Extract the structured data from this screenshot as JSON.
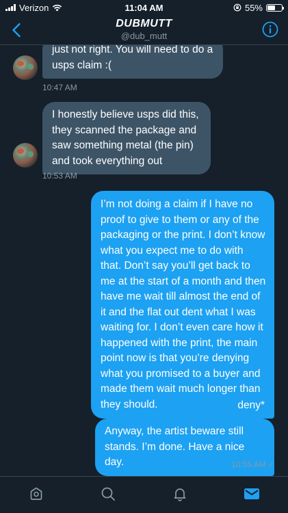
{
  "status_bar": {
    "carrier": "Verizon",
    "time": "11:04 AM",
    "battery": "55%",
    "battery_level": 0.55
  },
  "header": {
    "title": "DUBMUTT",
    "handle": "@dub_mutt"
  },
  "messages": [
    {
      "direction": "received",
      "text": "just not right. You will need to do a usps claim :(",
      "time": "10:47 AM"
    },
    {
      "direction": "received",
      "text": "I honestly believe usps did this, they scanned the package and saw something metal (the pin) and took everything out",
      "time": "10:53 AM"
    },
    {
      "direction": "sent",
      "text": "I’m not doing a claim if I have no proof to give to them or any of the packaging or the print. I don’t know what you expect me to do with that. Don’t say you’ll get back to me at the start of a month and then have me wait till almost the end of it and the flat out dent what I was waiting for. I don’t even care how it happened with the print, the main point now is that you’re denying what you promised to a buyer and made them wait much longer than they should."
    },
    {
      "direction": "sent",
      "text": "deny*"
    },
    {
      "direction": "sent",
      "text": "Anyway, the artist beware still stands. I’m done. Have a nice day.",
      "time": "10:55 AM",
      "read_check": "✓"
    }
  ],
  "tab_bar": {
    "items": [
      "home",
      "search",
      "notifications",
      "messages"
    ],
    "active": "messages"
  },
  "colors": {
    "background": "#15202b",
    "received_bubble": "#3d5466",
    "sent_bubble": "#1da1f2",
    "accent": "#1da1f2",
    "muted_text": "#8899a6"
  }
}
